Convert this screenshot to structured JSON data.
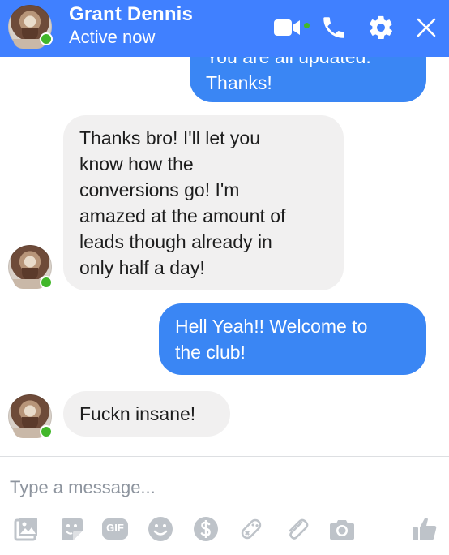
{
  "header": {
    "name": "Grant Dennis",
    "status": "Active now",
    "icons": [
      "video-call-icon",
      "phone-icon",
      "gear-icon",
      "close-icon"
    ]
  },
  "messages": [
    {
      "from": "me",
      "lines": [
        "You are all updated.",
        "Thanks!"
      ]
    },
    {
      "from": "them",
      "lines": [
        "Thanks bro! I'll let you",
        "know how the",
        "conversions go! I'm",
        "amazed at the amount of",
        "leads though already in",
        "only half a day!"
      ]
    },
    {
      "from": "me",
      "lines": [
        "Hell Yeah!! Welcome to",
        "the club!"
      ]
    },
    {
      "from": "them",
      "lines": [
        "Fuckn insane!"
      ]
    }
  ],
  "composer": {
    "placeholder": "Type a message...",
    "toolbar": [
      "photo-icon",
      "sticker-icon",
      "gif-icon",
      "emoji-icon",
      "payment-icon",
      "game-icon",
      "attachment-icon",
      "camera-icon",
      "like-icon"
    ],
    "gif_label": "GIF"
  },
  "colors": {
    "header": "#4080ff",
    "outgoing": "#3a86f4",
    "incoming": "#f1f0f0",
    "online": "#42b72a",
    "icon_gray": "#bec3c9"
  }
}
